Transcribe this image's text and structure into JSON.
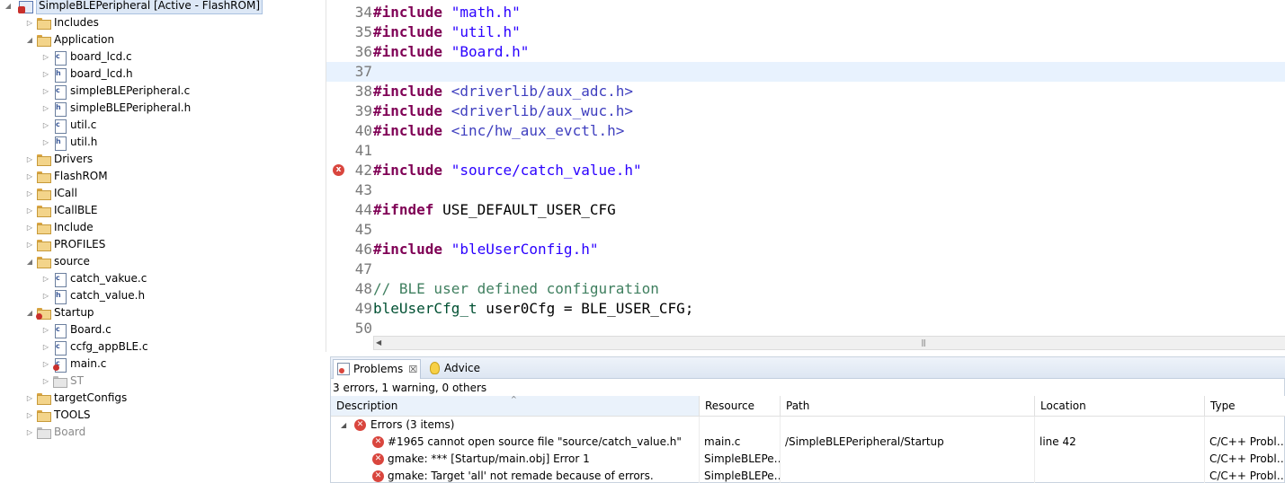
{
  "project_tree": {
    "root": {
      "label": "SimpleBLEPeripheral  [Active - FlashROM]"
    },
    "items": [
      {
        "label": "Includes",
        "kind": "includes-folder",
        "depth": 1,
        "expanded": false
      },
      {
        "label": "Application",
        "kind": "folder",
        "depth": 1,
        "expanded": true
      },
      {
        "label": "board_lcd.c",
        "kind": "c-file",
        "depth": 2
      },
      {
        "label": "board_lcd.h",
        "kind": "h-file",
        "depth": 2
      },
      {
        "label": "simpleBLEPeripheral.c",
        "kind": "c-file",
        "depth": 2
      },
      {
        "label": "simpleBLEPeripheral.h",
        "kind": "h-file",
        "depth": 2
      },
      {
        "label": "util.c",
        "kind": "c-file",
        "depth": 2
      },
      {
        "label": "util.h",
        "kind": "h-file",
        "depth": 2
      },
      {
        "label": "Drivers",
        "kind": "folder",
        "depth": 1,
        "expanded": false
      },
      {
        "label": "FlashROM",
        "kind": "folder",
        "depth": 1,
        "expanded": false
      },
      {
        "label": "ICall",
        "kind": "folder",
        "depth": 1,
        "expanded": false
      },
      {
        "label": "ICallBLE",
        "kind": "folder",
        "depth": 1,
        "expanded": false
      },
      {
        "label": "Include",
        "kind": "folder",
        "depth": 1,
        "expanded": false
      },
      {
        "label": "PROFILES",
        "kind": "folder",
        "depth": 1,
        "expanded": false
      },
      {
        "label": "source",
        "kind": "folder",
        "depth": 1,
        "expanded": true
      },
      {
        "label": "catch_vakue.c",
        "kind": "c-file",
        "depth": 2
      },
      {
        "label": "catch_value.h",
        "kind": "h-file",
        "depth": 2
      },
      {
        "label": "Startup",
        "kind": "folder-error",
        "depth": 1,
        "expanded": true
      },
      {
        "label": "Board.c",
        "kind": "c-file",
        "depth": 2
      },
      {
        "label": "ccfg_appBLE.c",
        "kind": "c-file",
        "depth": 2
      },
      {
        "label": "main.c",
        "kind": "c-file-error",
        "depth": 2
      },
      {
        "label": "ST",
        "kind": "folder-excluded",
        "depth": 2
      },
      {
        "label": "targetConfigs",
        "kind": "folder",
        "depth": 1,
        "expanded": false
      },
      {
        "label": "TOOLS",
        "kind": "folder",
        "depth": 1,
        "expanded": false
      },
      {
        "label": "Board",
        "kind": "folder-excluded",
        "depth": 1,
        "expanded": false
      }
    ]
  },
  "editor": {
    "lines": [
      {
        "num": "34",
        "tokens": [
          {
            "t": "#include",
            "c": "kw"
          },
          {
            "t": " ",
            "c": ""
          },
          {
            "t": "\"math.h\"",
            "c": "str"
          }
        ]
      },
      {
        "num": "35",
        "tokens": [
          {
            "t": "#include",
            "c": "kw"
          },
          {
            "t": " ",
            "c": ""
          },
          {
            "t": "\"util.h\"",
            "c": "str"
          }
        ]
      },
      {
        "num": "36",
        "tokens": [
          {
            "t": "#include",
            "c": "kw"
          },
          {
            "t": " ",
            "c": ""
          },
          {
            "t": "\"Board.h\"",
            "c": "str"
          }
        ]
      },
      {
        "num": "37",
        "tokens": [],
        "current": true
      },
      {
        "num": "38",
        "tokens": [
          {
            "t": "#include",
            "c": "kw"
          },
          {
            "t": " ",
            "c": ""
          },
          {
            "t": "<driverlib/aux_adc.h>",
            "c": "inc"
          }
        ]
      },
      {
        "num": "39",
        "tokens": [
          {
            "t": "#include",
            "c": "kw"
          },
          {
            "t": " ",
            "c": ""
          },
          {
            "t": "<driverlib/aux_wuc.h>",
            "c": "inc"
          }
        ]
      },
      {
        "num": "40",
        "tokens": [
          {
            "t": "#include",
            "c": "kw"
          },
          {
            "t": " ",
            "c": ""
          },
          {
            "t": "<inc/hw_aux_evctl.h>",
            "c": "inc"
          }
        ]
      },
      {
        "num": "41",
        "tokens": []
      },
      {
        "num": "42",
        "tokens": [
          {
            "t": "#include",
            "c": "kw"
          },
          {
            "t": " ",
            "c": ""
          },
          {
            "t": "\"source/catch_value.h\"",
            "c": "str"
          }
        ],
        "error": true
      },
      {
        "num": "43",
        "tokens": []
      },
      {
        "num": "44",
        "tokens": [
          {
            "t": "#ifndef",
            "c": "kw"
          },
          {
            "t": " USE_DEFAULT_USER_CFG",
            "c": ""
          }
        ]
      },
      {
        "num": "45",
        "tokens": []
      },
      {
        "num": "46",
        "tokens": [
          {
            "t": "#include",
            "c": "kw"
          },
          {
            "t": " ",
            "c": ""
          },
          {
            "t": "\"bleUserConfig.h\"",
            "c": "str"
          }
        ]
      },
      {
        "num": "47",
        "tokens": []
      },
      {
        "num": "48",
        "tokens": [
          {
            "t": "// BLE user defined configuration",
            "c": "cmt"
          }
        ]
      },
      {
        "num": "49",
        "tokens": [
          {
            "t": "bleUserCfg_t",
            "c": "typ"
          },
          {
            "t": " user0Cfg = BLE_USER_CFG;",
            "c": ""
          }
        ]
      },
      {
        "num": "50",
        "tokens": []
      }
    ],
    "error_marker": "x"
  },
  "problems": {
    "tabs": [
      {
        "label": "Problems",
        "active": true,
        "icon": "problems-icon",
        "closable": true
      },
      {
        "label": "Advice",
        "active": false,
        "icon": "lightbulb-icon",
        "closable": false
      }
    ],
    "close_glyph": "☒",
    "summary": "3 errors, 1 warning, 0 others",
    "columns": [
      "Description",
      "Resource",
      "Path",
      "Location",
      "Type"
    ],
    "sort_indicator": "^",
    "group": {
      "label": "Errors (3 items)",
      "expanded": true
    },
    "rows": [
      {
        "description": "#1965 cannot open source file \"source/catch_value.h\"",
        "resource": "main.c",
        "path": "/SimpleBLEPeripheral/Startup",
        "location": "line 42",
        "type": "C/C++ Probl…"
      },
      {
        "description": "gmake: *** [Startup/main.obj] Error 1",
        "resource": "SimpleBLEPe…",
        "path": "",
        "location": "",
        "type": "C/C++ Probl…"
      },
      {
        "description": "gmake: Target 'all' not remade because of errors.",
        "resource": "SimpleBLEPe…",
        "path": "",
        "location": "",
        "type": "C/C++ Probl…"
      }
    ]
  },
  "colors": {
    "keyword": "#7f0055",
    "string": "#2a00ff",
    "comment": "#3f7f5f",
    "error": "#d9463e",
    "current_line": "#e8f2fe"
  }
}
